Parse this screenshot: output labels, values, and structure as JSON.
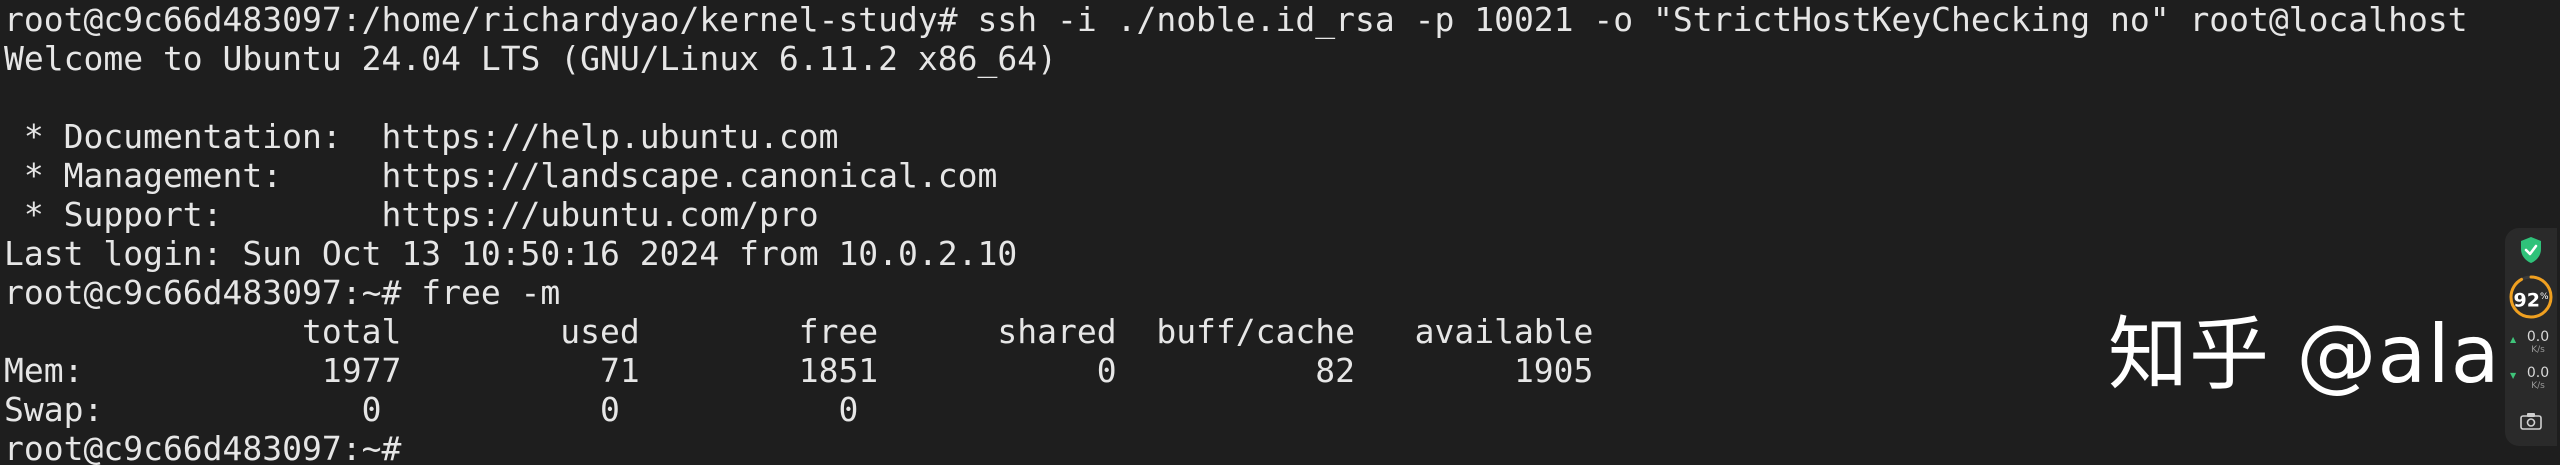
{
  "terminal": {
    "lines": [
      "root@c9c66d483097:/home/richardyao/kernel-study# ssh -i ./noble.id_rsa -p 10021 -o \"StrictHostKeyChecking no\" root@localhost",
      "Welcome to Ubuntu 24.04 LTS (GNU/Linux 6.11.2 x86_64)",
      "",
      " * Documentation:  https://help.ubuntu.com",
      " * Management:     https://landscape.canonical.com",
      " * Support:        https://ubuntu.com/pro",
      "Last login: Sun Oct 13 10:50:16 2024 from 10.0.2.10",
      "root@c9c66d483097:~# free -m",
      "               total        used        free      shared  buff/cache   available",
      "Mem:            1977          71        1851           0          82        1905",
      "Swap:             0           0           0",
      "root@c9c66d483097:~# "
    ]
  },
  "watermark": {
    "text": "知乎 @alai"
  },
  "system_widget": {
    "shield_icon": "shield-check-icon",
    "cpu_percent": "92",
    "cpu_unit": "%",
    "upload_value": "0.0",
    "upload_unit": "K/s",
    "download_value": "0.0",
    "download_unit": "K/s",
    "camera_icon": "camera-icon",
    "colors": {
      "accent_green": "#2fc27a",
      "gauge_orange": "#f0a020"
    }
  }
}
